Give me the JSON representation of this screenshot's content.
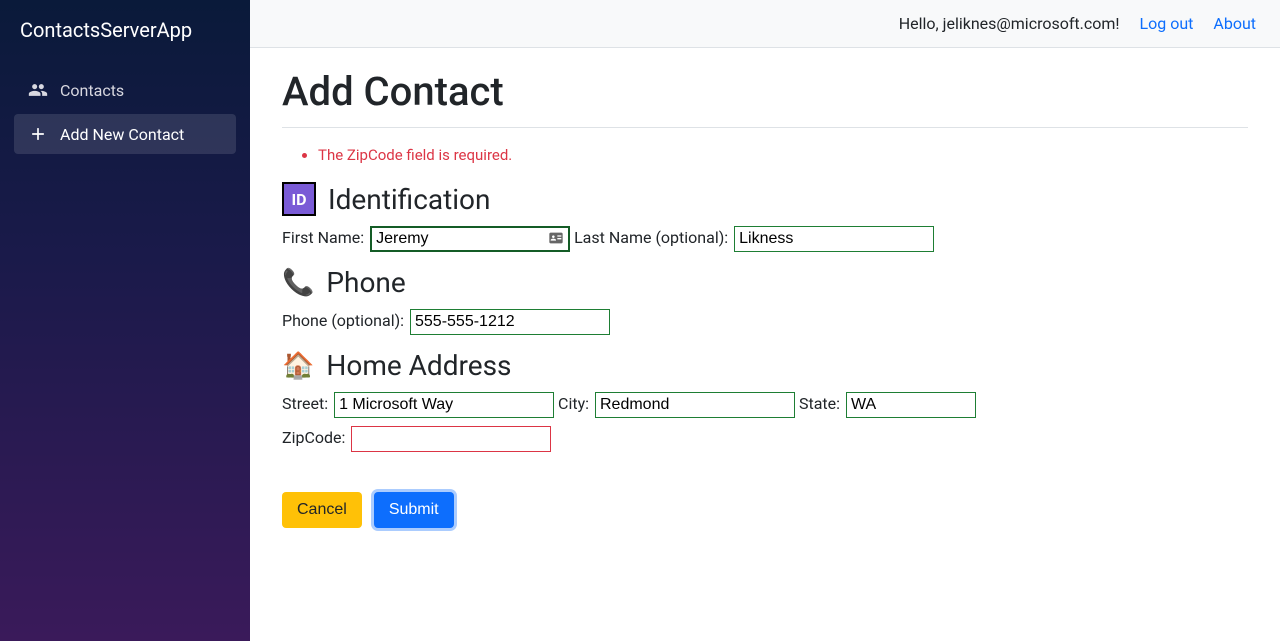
{
  "app": {
    "title": "ContactsServerApp"
  },
  "sidebar": {
    "items": [
      {
        "label": "Contacts"
      },
      {
        "label": "Add New Contact"
      }
    ]
  },
  "topbar": {
    "greeting": "Hello, jeliknes@microsoft.com!",
    "logout": "Log out",
    "about": "About"
  },
  "page": {
    "heading": "Add Contact",
    "validation": [
      "The ZipCode field is required."
    ],
    "sections": {
      "identification": "Identification",
      "phone": "Phone",
      "home": "Home Address"
    },
    "labels": {
      "first_name": "First Name:",
      "last_name": "Last Name (optional):",
      "phone": "Phone (optional):",
      "street": "Street:",
      "city": "City:",
      "state": "State:",
      "zip": "ZipCode:"
    },
    "values": {
      "first_name": "Jeremy",
      "last_name": "Likness",
      "phone": "555-555-1212",
      "street": "1 Microsoft Way",
      "city": "Redmond",
      "state": "WA",
      "zip": ""
    },
    "buttons": {
      "cancel": "Cancel",
      "submit": "Submit"
    },
    "id_badge": "ID"
  }
}
